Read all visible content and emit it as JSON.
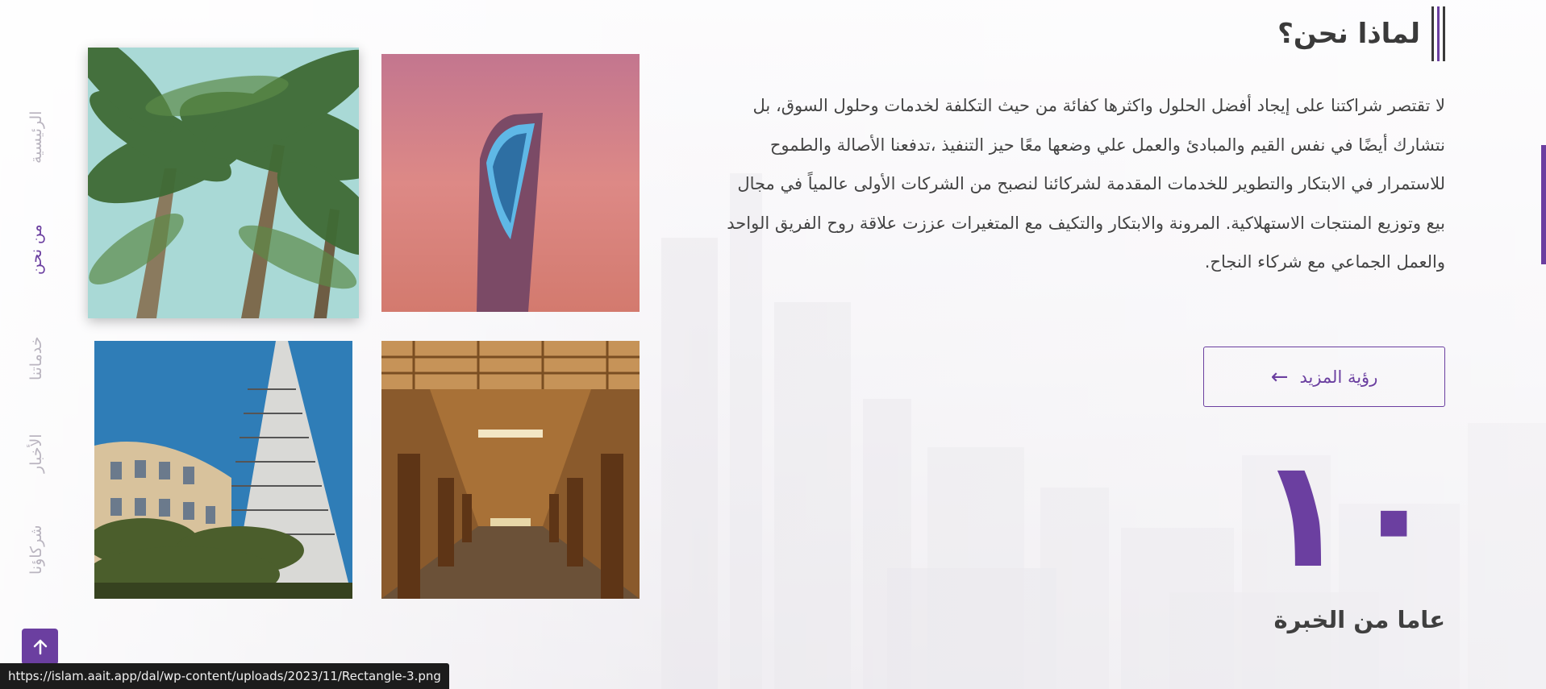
{
  "nav": {
    "items": [
      {
        "label": "الرئيسية",
        "active": false
      },
      {
        "label": "من نحن",
        "active": true
      },
      {
        "label": "خدماتنا",
        "active": false
      },
      {
        "label": "الأخبار",
        "active": false
      },
      {
        "label": "شركاؤنا",
        "active": false
      }
    ]
  },
  "about": {
    "title": "لماذا نحن؟",
    "paragraph": "لا تقتصر شراكتنا على إيجاد أفضل الحلول واكثرها كفائة من حيث التكلفة لخدمات وحلول السوق، بل نتشارك أيضًا في نفس القيم والمبادئ والعمل علي وضعها معًا حيز التنفيذ ،تدفعنا الأصالة والطموح للاستمرار في الابتكار والتطوير للخدمات المقدمة لشركائنا لنصبح من الشركات الأولى عالمياً في مجال بيع وتوزيع المنتجات الاستهلاكية. المرونة والابتكار والتكيف مع المتغيرات عززت علاقة روح الفريق الواحد والعمل الجماعي مع شركاء النجاح.",
    "more_label": "رؤية المزيد",
    "more_arrow": "←"
  },
  "stats": {
    "value": "١٠",
    "label": "عاما من الخبرة"
  },
  "images": [
    {
      "name": "palm-trees-photo"
    },
    {
      "name": "kingdom-tower-photo"
    },
    {
      "name": "faisaliah-tower-photo"
    },
    {
      "name": "arcade-corridor-photo"
    }
  ],
  "status_bar": {
    "url": "https://islam.aait.app/dal/wp-content/uploads/2023/11/Rectangle-3.png"
  },
  "colors": {
    "accent": "#6b3fa0",
    "text": "#444444",
    "heading": "#3a3a3a"
  },
  "icons": {
    "scroll_top": "arrow-up-icon",
    "more": "arrow-left-icon"
  }
}
